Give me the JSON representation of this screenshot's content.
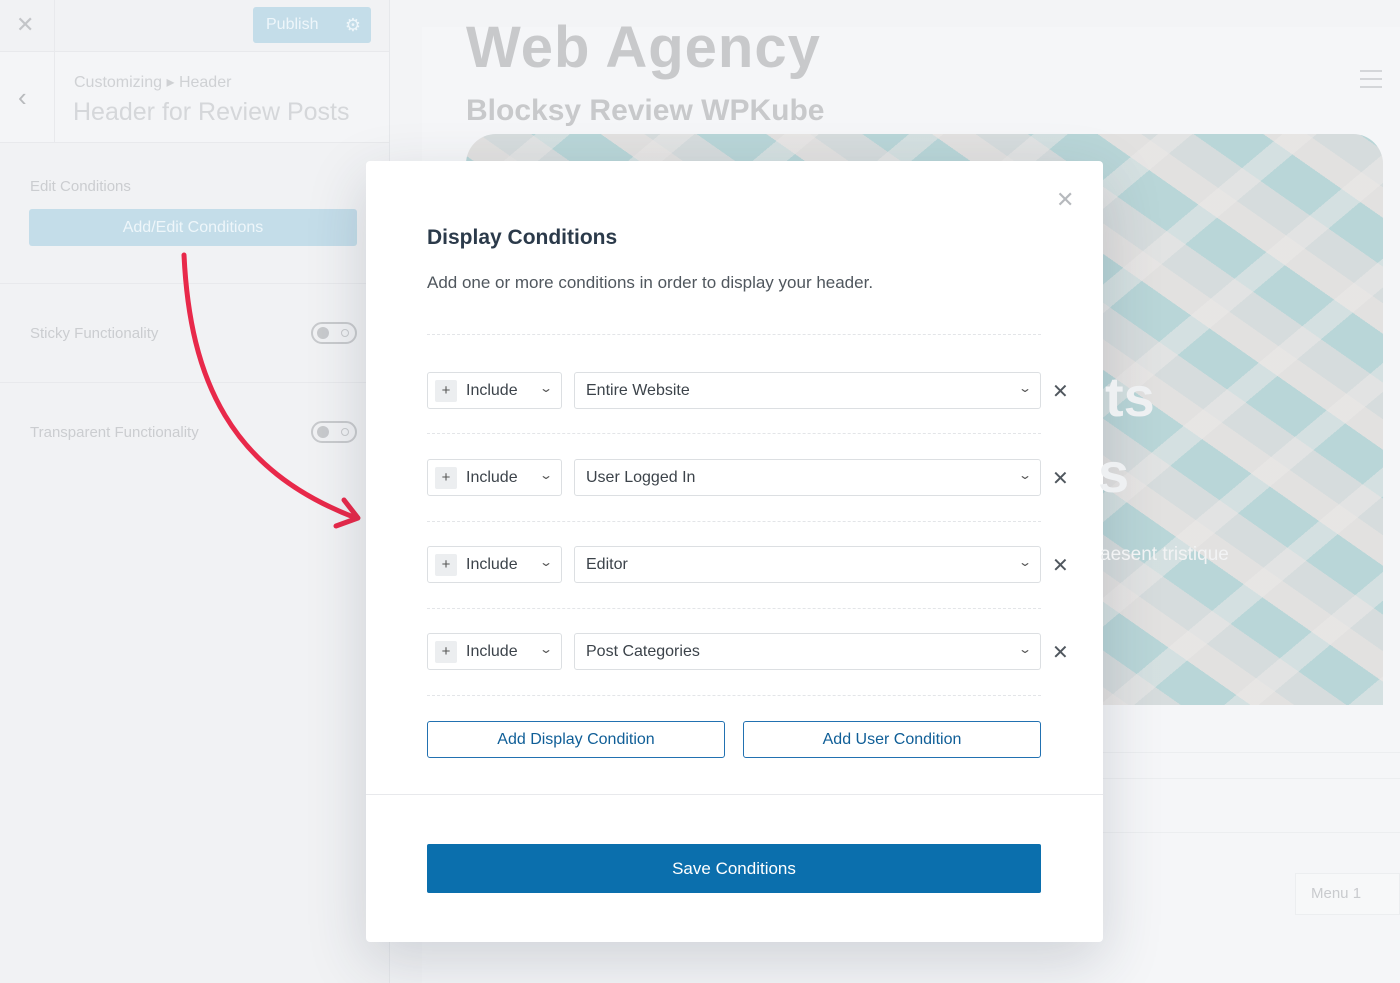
{
  "sidebar": {
    "publish_label": "Publish",
    "breadcrumb": "Customizing ▸ Header",
    "panel_title": "Header for Review Posts",
    "edit_conditions_label": "Edit Conditions",
    "add_edit_button": "Add/Edit Conditions",
    "sticky_label": "Sticky Functionality",
    "transparent_label": "Transparent Functionality",
    "sticky_enabled": false,
    "transparent_enabled": false
  },
  "preview": {
    "site_title": "Web Agency",
    "site_tagline": "Blocksy Review WPKube",
    "hero_text_1": "ts",
    "hero_text_2": "s",
    "hero_paragraph": "aesent tristique",
    "menu_item": "Menu 1"
  },
  "modal": {
    "title": "Display Conditions",
    "description": "Add one or more conditions in order to display your header.",
    "conditions": [
      {
        "type": "Include",
        "value": "Entire Website"
      },
      {
        "type": "Include",
        "value": "User Logged In"
      },
      {
        "type": "Include",
        "value": "Editor"
      },
      {
        "type": "Include",
        "value": "Post Categories"
      }
    ],
    "add_display_condition": "Add Display Condition",
    "add_user_condition": "Add User Condition",
    "save_label": "Save Conditions"
  },
  "colors": {
    "primary": "#0b6fad",
    "annotation_arrow": "#e8294a"
  }
}
